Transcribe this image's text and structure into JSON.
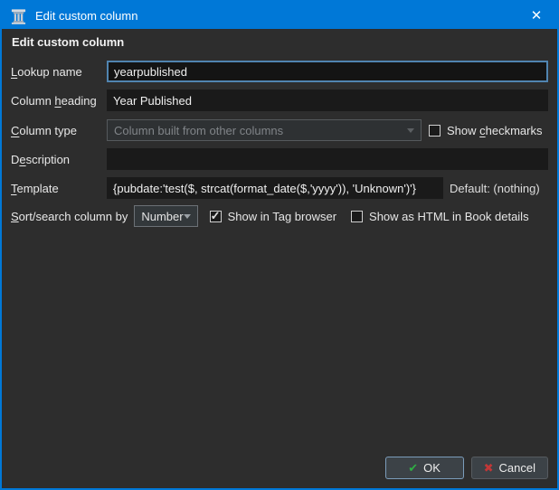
{
  "window": {
    "title": "Edit custom column",
    "close_icon": "✕"
  },
  "colors": {
    "titlebar": "#0078d7",
    "dialog_bg": "#2d2d2d",
    "focus_border": "#5084b0",
    "ok_check": "#2fae44",
    "cancel_x": "#c23737"
  },
  "heading": "Edit custom column",
  "form": {
    "lookup_name": {
      "label": "&Lookup name",
      "value": "yearpublished"
    },
    "column_heading": {
      "label": "Column &heading",
      "value": "Year Published"
    },
    "column_type": {
      "label": "&Column type",
      "value": "Column built from other columns",
      "disabled": true,
      "show_checkmarks": {
        "label": "Show &checkmarks",
        "checked": false
      }
    },
    "description": {
      "label": "D&escription",
      "value": ""
    },
    "template": {
      "label": "&Template",
      "value": "{pubdate:'test($, strcat(format_date($,'yyyy')), 'Unknown')'}",
      "default_note": "Default: (nothing)"
    },
    "sort_search": {
      "label": "&Sort/search column by",
      "value": "Number",
      "show_in_tag_browser": {
        "label": "Show in Tag browser",
        "checked": true
      },
      "show_as_html": {
        "label": "Show as HTML in Book details",
        "checked": false
      }
    }
  },
  "buttons": {
    "ok": {
      "label": "OK",
      "icon": "✔"
    },
    "cancel": {
      "label": "Cancel",
      "icon": "✖"
    }
  }
}
